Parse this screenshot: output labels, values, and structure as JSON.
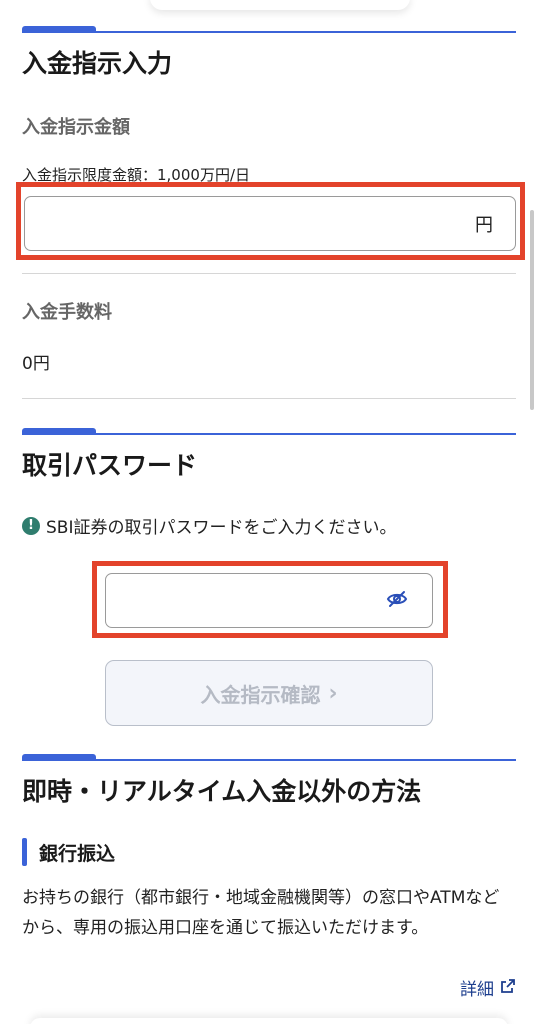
{
  "deposit_section": {
    "title": "入金指示入力",
    "amount_label": "入金指示金額",
    "limit_text": "入金指示限度金額：1,000万円/日",
    "amount_value": "",
    "amount_unit": "円",
    "fee_label": "入金手数料",
    "fee_value": "0円"
  },
  "password_section": {
    "title": "取引パスワード",
    "info_icon": "!",
    "info_text": "SBI証券の取引パスワードをご入力ください。",
    "password_value": "",
    "confirm_label": "入金指示確認",
    "confirm_chevron": "›"
  },
  "other_methods": {
    "title": "即時・リアルタイム入金以外の方法",
    "bank_transfer_label": "銀行振込",
    "description": "お持ちの銀行（都市銀行・地域金融機関等）の窓口やATMなどから、専用の振込用口座を通じて振込いただけます。",
    "detail_link": "詳細"
  },
  "colors": {
    "accent": "#3b63d8",
    "highlight": "#e3432b",
    "info": "#2f7d6e",
    "link": "#1e3f8e"
  },
  "icons": {
    "password_toggle": "eye-off-icon",
    "external_link": "external-link-icon",
    "info": "info-icon"
  }
}
